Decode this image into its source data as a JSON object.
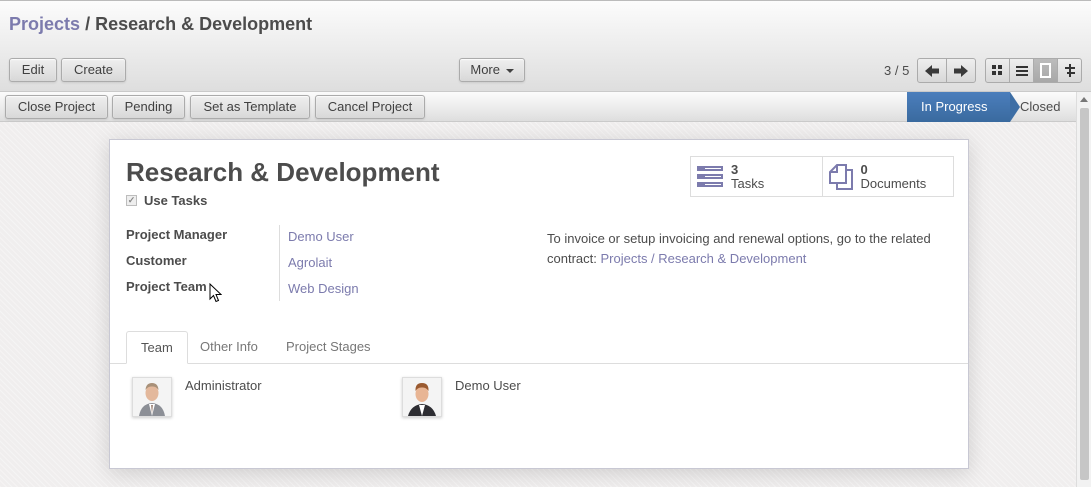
{
  "breadcrumb": {
    "parent": "Projects",
    "separator": "/",
    "current": "Research & Development"
  },
  "toolbar": {
    "edit_label": "Edit",
    "create_label": "Create",
    "more_label": "More",
    "pager_text": "3 / 5"
  },
  "statusbar": {
    "buttons": [
      "Close Project",
      "Pending",
      "Set as Template",
      "Cancel Project"
    ],
    "stages": {
      "active": "In Progress",
      "next": "Closed"
    }
  },
  "sheet": {
    "title": "Research & Development",
    "use_tasks_label": "Use Tasks",
    "use_tasks_checked": true,
    "stats": [
      {
        "count": "3",
        "label": "Tasks",
        "icon": "tasks-icon"
      },
      {
        "count": "0",
        "label": "Documents",
        "icon": "documents-icon"
      }
    ],
    "fields": [
      {
        "label": "Project Manager",
        "value": "Demo User"
      },
      {
        "label": "Customer",
        "value": "Agrolait"
      },
      {
        "label": "Project Team",
        "value": "Web Design"
      }
    ],
    "invoice_text": "To invoice or setup invoicing and renewal options, go to the related contract:",
    "invoice_link": "Projects / Research & Development",
    "tabs": [
      "Team",
      "Other Info",
      "Project Stages"
    ],
    "members": [
      {
        "name": "Administrator"
      },
      {
        "name": "Demo User"
      }
    ]
  },
  "colors": {
    "link": "#7c7bad",
    "stage_active": "#3d6ea5"
  }
}
